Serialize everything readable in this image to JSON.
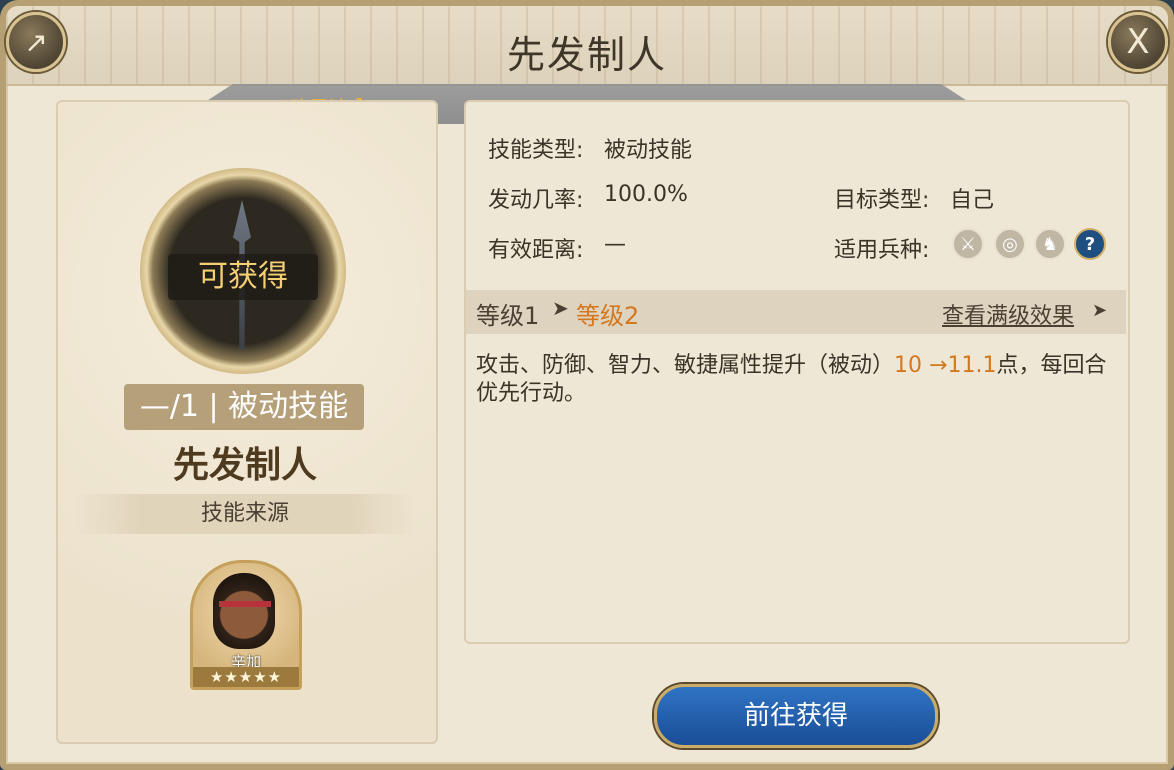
{
  "header": {
    "title": "先发制人",
    "share_icon": "share-icon",
    "close_label": "X"
  },
  "ribbon": {
    "text": "|欧尼达 】。"
  },
  "skill": {
    "status": "可获得",
    "level_tag": "—/1 | 被动技能",
    "name": "先发制人",
    "source_label": "技能来源"
  },
  "hero": {
    "name": "辛加",
    "stars": "★★★★★"
  },
  "info": {
    "type_label": "技能类型:",
    "type_value": "被动技能",
    "chance_label": "发动几率:",
    "chance_value": "100.0%",
    "target_label": "目标类型:",
    "target_value": "自己",
    "range_label": "有效距离:",
    "range_value": "—",
    "troops_label": "适用兵种:",
    "troop_icons": [
      "sword-icon",
      "target-icon",
      "horse-icon",
      "question-icon"
    ]
  },
  "levels": {
    "current": "等级1",
    "arrow": "➤",
    "next": "等级2",
    "max_link": "查看满级效果",
    "max_arrow": "➤"
  },
  "description": {
    "prefix": "攻击、防御、智力、敏捷属性提升（被动）",
    "from": "10",
    "arrow": "→",
    "to": "11.1",
    "suffix": "点，每回合优先行动。"
  },
  "actions": {
    "go_label": "前往获得"
  },
  "colors": {
    "accent": "#d4781e",
    "button": "#1f5ba8",
    "frame": "#b79f74"
  }
}
